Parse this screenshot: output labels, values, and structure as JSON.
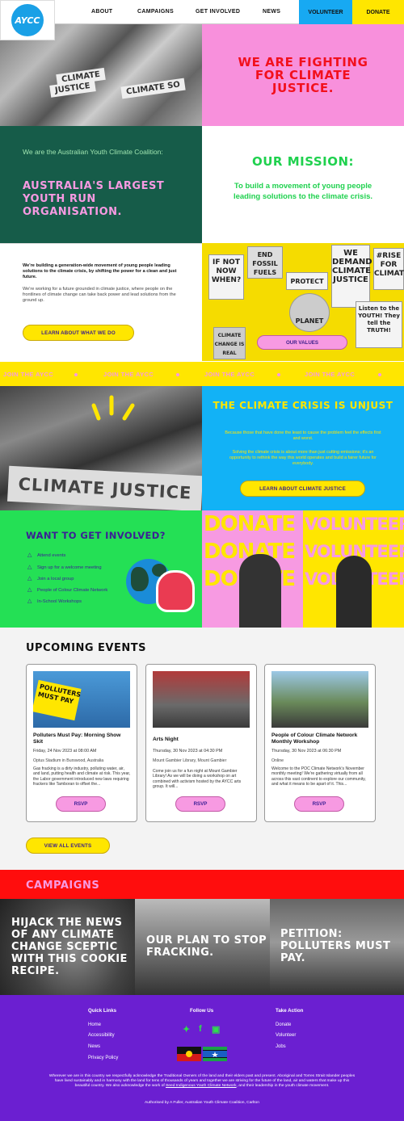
{
  "header": {
    "logo_text": "AYCC",
    "nav": [
      "ABOUT",
      "CAMPAIGNS",
      "GET INVOLVED",
      "NEWS"
    ],
    "volunteer_label": "VOLUNTEER",
    "donate_label": "DONATE"
  },
  "hero": {
    "title": "WE ARE FIGHTING FOR CLIMATE JUSTICE.",
    "banner_texts": [
      "CLIMATE",
      "JUSTICE",
      "CLIMATE SO"
    ]
  },
  "intro": {
    "subtitle": "We are the Australian Youth Climate Coalition:",
    "headline": "AUSTRALIA'S LARGEST YOUTH RUN ORGANISATION."
  },
  "mission": {
    "title": "OUR MISSION:",
    "text": "To build a movement of young people leading solutions to the climate crisis."
  },
  "building": {
    "bold_text": "We're building a generation-wide movement of young people leading solutions to the climate crisis, by shifting the power for a clean and just future.",
    "paragraph": "We're working for a future grounded in climate justice, where people on the frontlines of climate change can take back power and lead solutions from the ground up.",
    "button_label": "LEARN ABOUT WHAT WE DO",
    "values_button_label": "OUR VALUES",
    "signs": [
      "IF NOT NOW WHEN?",
      "END FOSSIL FUELS",
      "PROTECT",
      "WE DEMAND CLIMATE JUSTICE",
      "#RISE FOR CLIMATE",
      "PLANET",
      "CLIMATE CHANGE IS REAL",
      "Listen to the YOUTH! They tell the TRUTH!"
    ]
  },
  "ticker": {
    "items": [
      "JOIN THE AYCC",
      "JOIN THE AYCC",
      "JOIN THE AYCC",
      "JOIN THE AYCC"
    ]
  },
  "crisis": {
    "banner_text": "CLIMATE JUSTICE",
    "title": "THE CLIMATE CRISIS IS UNJUST",
    "p1": "Because those that have done the least to cause the problem feel the effects first and worst.",
    "p2": "Solving the climate crisis is about more than just cutting emissions; it's an opportunity to rethink the way this world operates and build a fairer future for everybody.",
    "button_label": "LEARN ABOUT CLIMATE JUSTICE"
  },
  "involved": {
    "title": "WANT TO GET INVOLVED?",
    "items": [
      "Attend events",
      "Sign up for a welcome meeting",
      "Join a local group",
      "People of Colour Climate Network",
      "In-School Workshops"
    ],
    "words": [
      "DONATE",
      "VOLUNTEER"
    ]
  },
  "events": {
    "title": "UPCOMING EVENTS",
    "cards": [
      {
        "name": "Polluters Must Pay: Morning Show Skit",
        "date": "Friday, 24 Nov 2023 at 08:00 AM",
        "location": "Optus Stadium in Burswood, Australia",
        "desc": "Gas fracking is a dirty industry, polluting water, air, and land, putting health and climate at risk. This year, the Labor government introduced new laws requiring frackers like Tamboran to offset the...",
        "rsvp": "RSVP",
        "sign_text": "POLLUTERS MUST PAY"
      },
      {
        "name": "Arts Night",
        "date": "Thursday, 30 Nov 2023 at 04:30 PM",
        "location": "Mount Gambier Library, Mount Gambier",
        "desc": "Come join us for a fun night at Mount Gambier Library! As we will be doing a workshop on art combined with activism hosted by the AYCC arts group. It will...",
        "rsvp": "RSVP"
      },
      {
        "name": "People of Colour Climate Network Monthly Workshop",
        "date": "Thursday, 30 Nov 2023 at 06:30 PM",
        "location": "Online",
        "desc": "Welcome to the POC Climate Network's November monthly meeting! We're gathering virtually from all across this vast continent to explore our community, and what it means to be apart of it. This...",
        "rsvp": "RSVP"
      }
    ],
    "view_all_label": "VIEW ALL EVENTS"
  },
  "campaigns": {
    "title": "CAMPAIGNS",
    "items": [
      "HIJACK THE NEWS OF ANY CLIMATE CHANGE SCEPTIC WITH THIS COOKIE RECIPE.",
      "OUR PLAN TO STOP FRACKING.",
      "PETITION: POLLUTERS MUST PAY."
    ]
  },
  "footer": {
    "quick_links_title": "Quick Links",
    "quick_links": [
      "Home",
      "Accessibility",
      "News",
      "Privacy Policy"
    ],
    "follow_title": "Follow Us",
    "take_action_title": "Take Action",
    "take_action_links": [
      "Donate",
      "Volunteer",
      "Jobs"
    ],
    "ack_before": "Wherever we are in this country we respectfully acknowledge the Traditional Owners of the land and their elders past and present. Aboriginal and Torres Strait Islander peoples have lived sustainably and in harmony with the land for tens of thousands of years and together we are striving for the future of the land, air and waters that make up this beautiful country. We also acknowledge the work of ",
    "ack_link": "Seed Indigenous Youth Climate Network",
    "ack_after": ", and their leadership in the youth climate movement.",
    "authorised": "Authorised by A Fuller, Australian Youth Climate Coalition, Carlton"
  },
  "colors": {
    "pink": "#f79ae2",
    "red": "#f2101c",
    "green_dark": "#165c49",
    "green_bright": "#24e055",
    "yellow": "#ffe600",
    "blue": "#12b2f6",
    "purple": "#6b1fd1",
    "navy_text": "#3c1f95"
  },
  "icons": [
    "aycc-logo-icon",
    "flame-bullet-icon",
    "twitter-icon",
    "facebook-icon",
    "instagram-icon",
    "aboriginal-flag-icon",
    "torres-strait-flag-icon"
  ]
}
